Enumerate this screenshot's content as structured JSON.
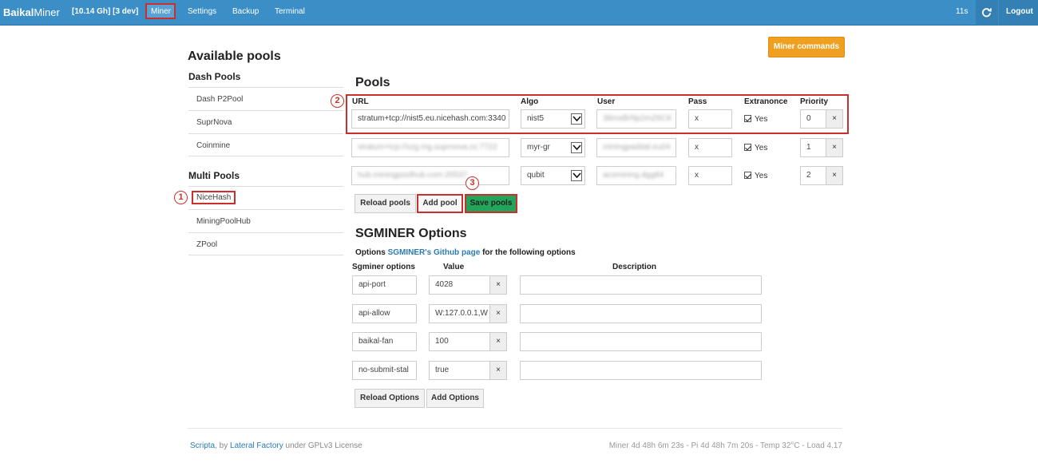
{
  "navbar": {
    "brand_bold": "Baikal",
    "brand_rest": "Miner",
    "status": "[10.14 Gh] [3 dev]",
    "links": [
      "Miner",
      "Settings",
      "Backup",
      "Terminal"
    ],
    "timer": "11s",
    "logout": "Logout"
  },
  "sidebar": {
    "title": "Available pools",
    "groups": [
      {
        "title": "Dash Pools",
        "items": [
          "Dash P2Pool",
          "SuprNova",
          "Coinmine"
        ]
      },
      {
        "title": "Multi Pools",
        "items": [
          "NiceHash",
          "MiningPoolHub",
          "ZPool"
        ]
      }
    ]
  },
  "annotations": [
    "1",
    "2",
    "3"
  ],
  "miner_commands": "Miner commands",
  "pools": {
    "title": "Pools",
    "columns": [
      "URL",
      "Algo",
      "User",
      "Pass",
      "Extranonce",
      "Priority"
    ],
    "rows": [
      {
        "url": "stratum+tcp://nist5.eu.nicehash.com:3340",
        "algo": "nist5",
        "user": "38mxBrNp2mZ6C8",
        "pass": "x",
        "extranonce": "Yes",
        "priority": "0"
      },
      {
        "url": "stratum+tcp://xzg.mg.suprnova.cc:7722",
        "algo": "myr-gr",
        "user": "miningpaddal.eu04",
        "pass": "x",
        "extranonce": "Yes",
        "priority": "1"
      },
      {
        "url": "hub.miningpoolhub.com:20537",
        "algo": "qubit",
        "user": "acomining.dgg84",
        "pass": "x",
        "extranonce": "Yes",
        "priority": "2"
      }
    ],
    "remove": "×",
    "buttons": {
      "reload": "Reload pools",
      "add": "Add pool",
      "save": "Save pools"
    }
  },
  "sgminer": {
    "title": "SGMINER Options",
    "note_prefix": "Options",
    "note_link": "SGMINER's Github page",
    "note_suffix": "for the following options",
    "columns": [
      "Sgminer options",
      "Value",
      "Description"
    ],
    "rows": [
      {
        "option": "api-port",
        "value": "4028"
      },
      {
        "option": "api-allow",
        "value": "W:127.0.0.1,W"
      },
      {
        "option": "baikal-fan",
        "value": "100"
      },
      {
        "option": "no-submit-stal",
        "value": "true"
      }
    ],
    "buttons": {
      "reload": "Reload Options",
      "add": "Add Options"
    }
  },
  "footer": {
    "scripta": "Scripta",
    "by": ", by",
    "lateral": "Lateral Factory",
    "license": "under GPLv3 License",
    "stats": "Miner 4d 48h 6m 23s  -  Pi 4d 48h 7m 20s  -  Temp 32°C  -  Load 4.17"
  }
}
